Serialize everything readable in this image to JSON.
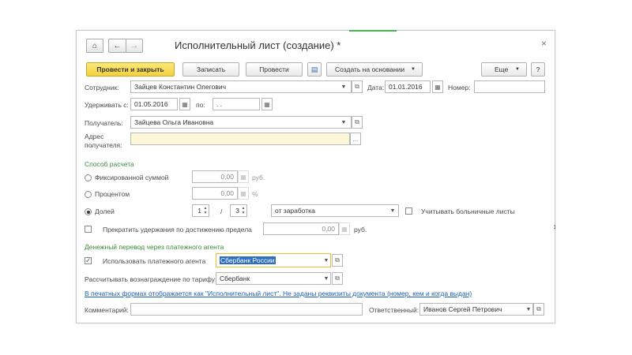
{
  "window": {
    "title": "Исполнительный лист (создание) *",
    "home_icon": "home-icon",
    "back_icon": "arrow-left-icon",
    "forward_icon": "arrow-right-icon",
    "close_glyph": "×",
    "accent_color": "#4caf50"
  },
  "toolbar": {
    "post_close": "Провести и закрыть",
    "save": "Записать",
    "post": "Провести",
    "create_based": "Создать на основании",
    "more": "Еще",
    "help": "?"
  },
  "employee": {
    "label": "Сотрудник:",
    "value": "Зайцев Константин Олегович"
  },
  "date": {
    "label": "Дата:",
    "value": "01.01.2016"
  },
  "number": {
    "label": "Номер:",
    "value": ""
  },
  "withhold": {
    "from_label": "Удерживать с:",
    "from_value": "01.05.2016",
    "to_label": "по:",
    "to_value": " .  ."
  },
  "recipient": {
    "label": "Получатель:",
    "value": "Зайцева Ольга Ивановна"
  },
  "address": {
    "label_line1": "Адрес",
    "label_line2": "получателя:",
    "value": "",
    "more": "..."
  },
  "calc": {
    "section_title": "Способ расчета",
    "fixed_label": "Фиксированной суммой",
    "fixed_value": "0,00",
    "fixed_unit": "руб.",
    "percent_label": "Процентом",
    "percent_value": "0,00",
    "percent_unit": "%",
    "share_label": "Долей",
    "share_num": "1",
    "share_sep": "/",
    "share_den": "3",
    "base_value": "от заработка",
    "sick_leave_label": "Учитывать больничные листы",
    "stop_label": "Прекратить удержания по достижению предела",
    "stop_value": "0,00",
    "stop_unit": "руб."
  },
  "agent": {
    "section_title": "Денежный перевод через платежного агента",
    "use_label": "Использовать платежного агента",
    "use_value": "Сбербанк России",
    "tariff_label": "Рассчитывать вознаграждение по тарифу:",
    "tariff_value": "Сбербанк"
  },
  "print_link": "В печатных формах отображается как \"Исполнительный лист\". Не заданы реквизиты документа (номер, кем и когда выдан)",
  "comment": {
    "label": "Комментарий:",
    "value": ""
  },
  "responsible": {
    "label": "Ответственный:",
    "value": "Иванов Сергей Петрович"
  }
}
